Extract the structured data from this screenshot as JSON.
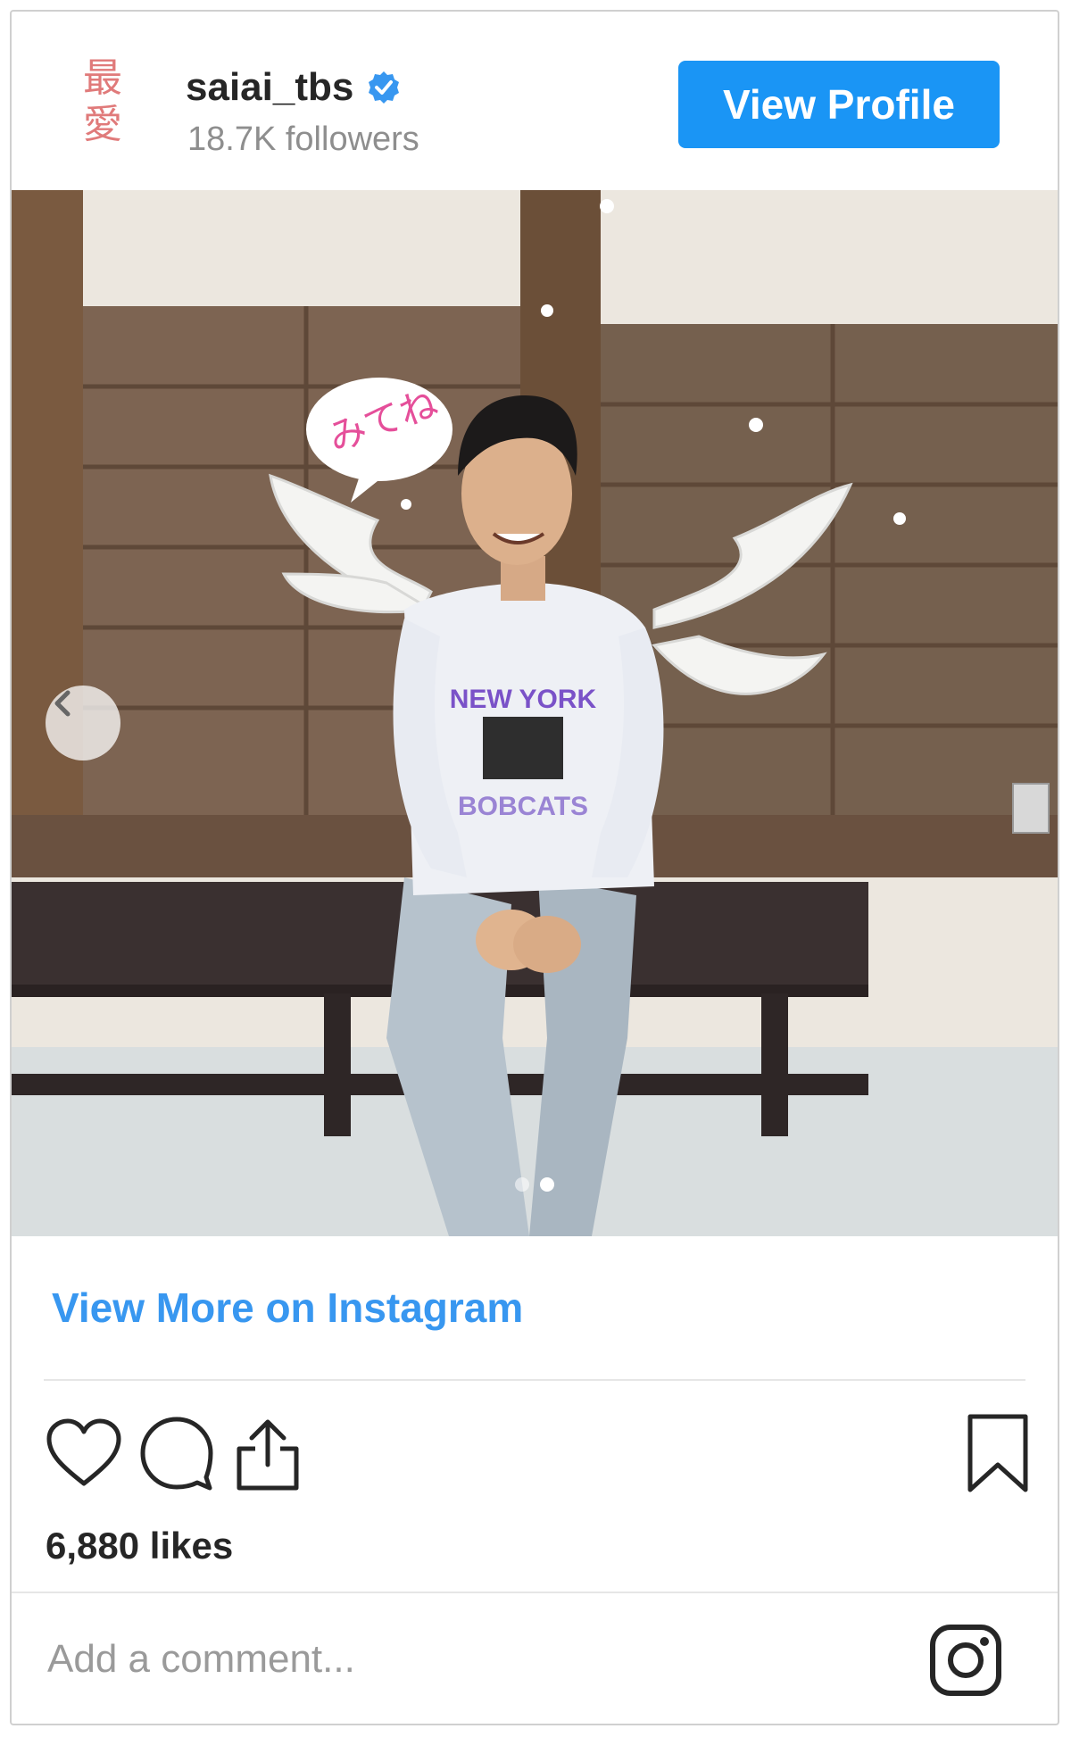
{
  "profile": {
    "avatar_chars": [
      "最",
      "愛"
    ],
    "username": "saiai_tbs",
    "followers": "18.7K followers",
    "view_profile_label": "View Profile"
  },
  "photo": {
    "speech_bubble_text": "みてね",
    "shirt_text_top": "NEW YORK",
    "shirt_text_bottom": "BOBCATS",
    "carousel_dots": 2,
    "active_dot": 2
  },
  "links": {
    "view_more": "View More on Instagram"
  },
  "engagement": {
    "likes": "6,880 likes"
  },
  "comment": {
    "placeholder": "Add a comment..."
  },
  "icons": [
    "verified-badge-icon",
    "chevron-left-icon",
    "heart-icon",
    "comment-icon",
    "share-icon",
    "bookmark-icon",
    "instagram-icon"
  ],
  "colors": {
    "accent": "#1a95f5",
    "link": "#3897f0",
    "avatar_text": "#e07a7a",
    "muted_text": "#8e8e8e"
  }
}
